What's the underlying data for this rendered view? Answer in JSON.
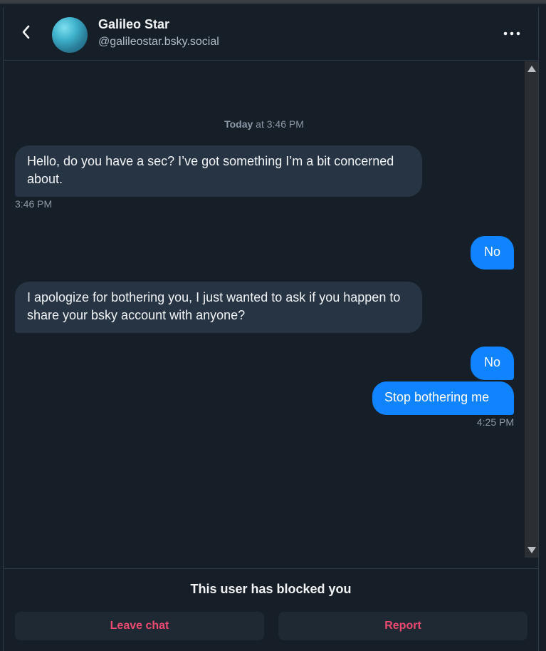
{
  "header": {
    "name": "Galileo Star",
    "handle": "@galileostar.bsky.social"
  },
  "chat": {
    "day_label_bold": "Today",
    "day_label_rest": " at 3:46 PM",
    "messages": [
      {
        "from": "them",
        "text": "Hello, do you have a sec? I’ve got something I’m a bit concerned about."
      },
      {
        "from": "them",
        "time": "3:46 PM"
      },
      {
        "from": "me",
        "text": "No"
      },
      {
        "from": "them",
        "text": "I apologize for bothering you, I just wanted to ask if you happen to share your bsky account with anyone?"
      },
      {
        "from": "me",
        "text": "No"
      },
      {
        "from": "me",
        "text": "Stop bothering me"
      },
      {
        "from": "me",
        "time": "4:25 PM"
      }
    ]
  },
  "footer": {
    "blocked_text": "This user has blocked you",
    "leave_label": "Leave chat",
    "report_label": "Report"
  },
  "colors": {
    "background": "#161e27",
    "incoming_bubble": "#263444",
    "outgoing_bubble": "#1083fe",
    "danger": "#ec4a6f"
  }
}
